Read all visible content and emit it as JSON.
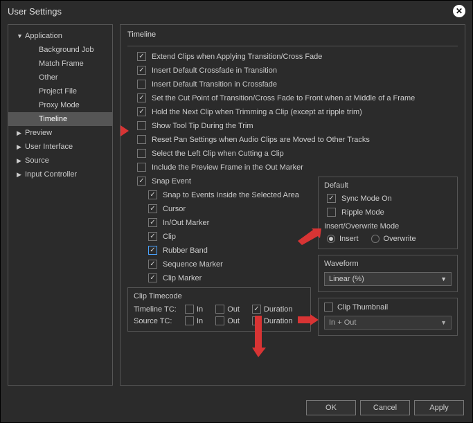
{
  "window": {
    "title": "User Settings"
  },
  "sidebar": {
    "items": [
      {
        "label": "Application",
        "level": 1,
        "arrow": "▼",
        "sel": false
      },
      {
        "label": "Background Job",
        "level": 2,
        "sel": false
      },
      {
        "label": "Match Frame",
        "level": 2,
        "sel": false
      },
      {
        "label": "Other",
        "level": 2,
        "sel": false
      },
      {
        "label": "Project File",
        "level": 2,
        "sel": false
      },
      {
        "label": "Proxy Mode",
        "level": 2,
        "sel": false
      },
      {
        "label": "Timeline",
        "level": 2,
        "sel": true
      },
      {
        "label": "Preview",
        "level": 1,
        "arrow": "▶",
        "sel": false
      },
      {
        "label": "User Interface",
        "level": 1,
        "arrow": "▶",
        "sel": false
      },
      {
        "label": "Source",
        "level": 1,
        "arrow": "▶",
        "sel": false
      },
      {
        "label": "Input Controller",
        "level": 1,
        "arrow": "▶",
        "sel": false
      }
    ]
  },
  "main": {
    "heading": "Timeline",
    "checks": [
      {
        "label": "Extend Clips when Applying Transition/Cross Fade",
        "on": true
      },
      {
        "label": "Insert Default Crossfade in Transition",
        "on": true
      },
      {
        "label": "Insert Default Transition in Crossfade",
        "on": false
      },
      {
        "label": "Set the Cut Point of Transition/Cross Fade to Front when at Middle of a Frame",
        "on": true
      },
      {
        "label": "Hold the Next Clip when Trimming a Clip (except at ripple trim)",
        "on": true
      },
      {
        "label": "Show Tool Tip During the Trim",
        "on": false
      },
      {
        "label": "Reset Pan Settings when Audio Clips are Moved to Other Tracks",
        "on": false
      },
      {
        "label": "Select the Left Clip when Cutting a Clip",
        "on": false
      },
      {
        "label": "Include the Preview Frame in the Out Marker",
        "on": false
      }
    ],
    "snap": {
      "label": "Snap Event",
      "on": true,
      "items": [
        {
          "label": "Snap to Events Inside the Selected Area",
          "on": true
        },
        {
          "label": "Cursor",
          "on": true
        },
        {
          "label": "In/Out Marker",
          "on": true
        },
        {
          "label": "Clip",
          "on": true
        },
        {
          "label": "Rubber Band",
          "on": true,
          "hl": true
        },
        {
          "label": "Sequence Marker",
          "on": true
        },
        {
          "label": "Clip Marker",
          "on": true
        }
      ]
    },
    "default": {
      "title": "Default",
      "sync": {
        "label": "Sync Mode On",
        "on": true
      },
      "ripple": {
        "label": "Ripple Mode",
        "on": false
      },
      "insert_title": "Insert/Overwrite Mode",
      "insert": {
        "label": "Insert",
        "on": true
      },
      "overwrite": {
        "label": "Overwrite",
        "on": false
      }
    },
    "waveform": {
      "title": "Waveform",
      "value": "Linear (%)"
    },
    "timecode": {
      "title": "Clip Timecode",
      "rows": [
        {
          "label": "Timeline TC:",
          "in": {
            "label": "In",
            "on": false
          },
          "out": {
            "label": "Out",
            "on": false
          },
          "dur": {
            "label": "Duration",
            "on": true
          }
        },
        {
          "label": "Source TC:",
          "in": {
            "label": "In",
            "on": false
          },
          "out": {
            "label": "Out",
            "on": false
          },
          "dur": {
            "label": "Duration",
            "on": false
          }
        }
      ]
    },
    "thumbnail": {
      "title": "Clip Thumbnail",
      "on": false,
      "value": "In + Out"
    }
  },
  "buttons": {
    "ok": "OK",
    "cancel": "Cancel",
    "apply": "Apply"
  }
}
